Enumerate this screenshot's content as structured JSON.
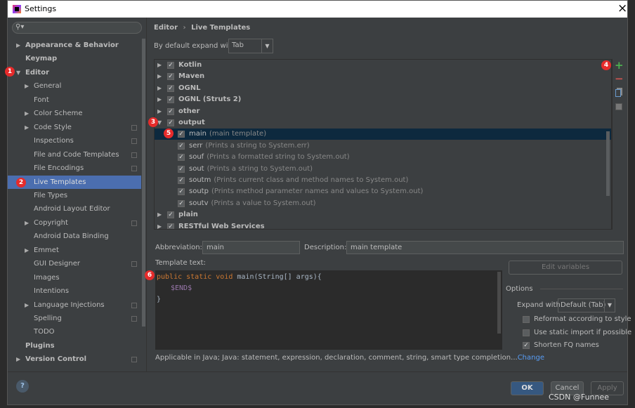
{
  "window": {
    "title": "Settings",
    "close": "×"
  },
  "sidebar": {
    "search_placeholder": "",
    "items": [
      {
        "label": "Appearance & Behavior",
        "level": 0,
        "arrow": "▶",
        "bold": true
      },
      {
        "label": "Keymap",
        "level": 0,
        "bold": true
      },
      {
        "label": "Editor",
        "level": 0,
        "arrow": "▼",
        "bold": true
      },
      {
        "label": "General",
        "level": 1,
        "arrow": "▶"
      },
      {
        "label": "Font",
        "level": 1
      },
      {
        "label": "Color Scheme",
        "level": 1,
        "arrow": "▶"
      },
      {
        "label": "Code Style",
        "level": 1,
        "arrow": "▶",
        "copy": true
      },
      {
        "label": "Inspections",
        "level": 1,
        "copy": true
      },
      {
        "label": "File and Code Templates",
        "level": 1,
        "copy": true
      },
      {
        "label": "File Encodings",
        "level": 1,
        "copy": true
      },
      {
        "label": "Live Templates",
        "level": 1,
        "selected": true
      },
      {
        "label": "File Types",
        "level": 1
      },
      {
        "label": "Android Layout Editor",
        "level": 1
      },
      {
        "label": "Copyright",
        "level": 1,
        "arrow": "▶",
        "copy": true
      },
      {
        "label": "Android Data Binding",
        "level": 1
      },
      {
        "label": "Emmet",
        "level": 1,
        "arrow": "▶"
      },
      {
        "label": "GUI Designer",
        "level": 1,
        "copy": true
      },
      {
        "label": "Images",
        "level": 1
      },
      {
        "label": "Intentions",
        "level": 1
      },
      {
        "label": "Language Injections",
        "level": 1,
        "arrow": "▶",
        "copy": true
      },
      {
        "label": "Spelling",
        "level": 1,
        "copy": true
      },
      {
        "label": "TODO",
        "level": 1
      },
      {
        "label": "Plugins",
        "level": 0,
        "bold": true
      },
      {
        "label": "Version Control",
        "level": 0,
        "arrow": "▶",
        "bold": true,
        "copy": true
      }
    ]
  },
  "breadcrumb": {
    "parent": "Editor",
    "sep": "›",
    "current": "Live Templates"
  },
  "expand_default": {
    "label": "By default expand with",
    "value": "Tab"
  },
  "tree": [
    {
      "name": "Kotlin",
      "group": true,
      "arrow": "▶"
    },
    {
      "name": "Maven",
      "group": true,
      "arrow": "▶"
    },
    {
      "name": "OGNL",
      "group": true,
      "arrow": "▶"
    },
    {
      "name": "OGNL (Struts 2)",
      "group": true,
      "arrow": "▶"
    },
    {
      "name": "other",
      "group": true,
      "arrow": "▶"
    },
    {
      "name": "output",
      "group": true,
      "arrow": "▼"
    },
    {
      "name": "main",
      "desc": "(main template)",
      "selected": true
    },
    {
      "name": "serr",
      "desc": "(Prints a string to System.err)"
    },
    {
      "name": "souf",
      "desc": "(Prints a formatted string to System.out)"
    },
    {
      "name": "sout",
      "desc": "(Prints a string to System.out)"
    },
    {
      "name": "soutm",
      "desc": "(Prints current class and method names to System.out)"
    },
    {
      "name": "soutp",
      "desc": "(Prints method parameter names and values to System.out)"
    },
    {
      "name": "soutv",
      "desc": "(Prints a value to System.out)"
    },
    {
      "name": "plain",
      "group": true,
      "arrow": "▶"
    },
    {
      "name": "RESTful Web Services",
      "group": true,
      "arrow": "▶"
    }
  ],
  "toolbar": {
    "add": "+",
    "remove": "−",
    "copy_icon": "copy-icon",
    "edit_icon": "list-icon",
    "add_color": "#4caf50",
    "remove_color": "#c75450"
  },
  "abbreviation": {
    "label": "Abbreviation:",
    "value": "main"
  },
  "description": {
    "label": "Description:",
    "value": "main template"
  },
  "template": {
    "label": "Template text:",
    "line1_kw": "public static void",
    "line1_rest": " main(String[] args){",
    "line2": "$END$",
    "line3": "}"
  },
  "edit_variables": "Edit variables",
  "options": {
    "title": "Options",
    "expand_label": "Expand with",
    "expand_value": "Default (Tab)",
    "checks": [
      {
        "label": "Reformat according to style",
        "checked": false
      },
      {
        "label": "Use static import if possible",
        "checked": false
      },
      {
        "label": "Shorten FQ names",
        "checked": true
      }
    ]
  },
  "applicable": {
    "text": "Applicable in Java; Java: statement, expression, declaration, comment, string, smart type completion...",
    "link": "Change"
  },
  "buttons": {
    "ok": "OK",
    "cancel": "Cancel",
    "apply": "Apply",
    "help": "?"
  },
  "badges": [
    "1",
    "2",
    "3",
    "4",
    "5",
    "6"
  ],
  "watermark": "CSDN @Funnee"
}
